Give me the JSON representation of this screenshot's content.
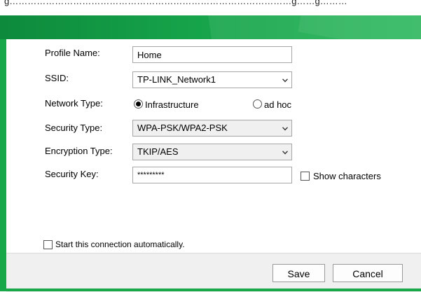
{
  "caption": "g…………………………………………………………………………………g……g………",
  "colors": {
    "accent_green": "#16a34a",
    "footer_bg": "#f0f0f0"
  },
  "form": {
    "profile_name": {
      "label": "Profile Name:",
      "value": "Home"
    },
    "ssid": {
      "label": "SSID:",
      "value": "TP-LINK_Network1"
    },
    "network_type": {
      "label": "Network Type:",
      "options": [
        {
          "label": "Infrastructure",
          "selected": true
        },
        {
          "label": "ad hoc",
          "selected": false
        }
      ]
    },
    "security_type": {
      "label": "Security Type:",
      "value": "WPA-PSK/WPA2-PSK"
    },
    "encryption_type": {
      "label": "Encryption Type:",
      "value": "TKIP/AES"
    },
    "security_key": {
      "label": "Security Key:",
      "value": "*********",
      "show_characters_label": "Show characters",
      "show_characters_checked": false
    }
  },
  "auto_connect": {
    "label": "Start this connection automatically.",
    "checked": false
  },
  "buttons": {
    "save": "Save",
    "cancel": "Cancel"
  }
}
